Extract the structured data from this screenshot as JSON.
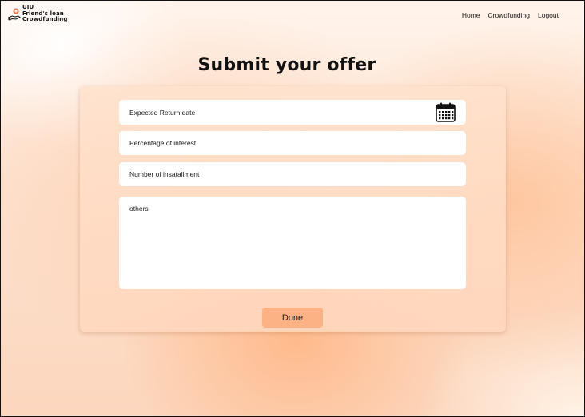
{
  "header": {
    "logo_lines": [
      "UIU",
      "Friend's loan",
      "Crowdfunding"
    ],
    "logo_icon": "hand-coin-icon",
    "nav": [
      "Home",
      "Crowdfunding",
      "Logout"
    ]
  },
  "title": "Submit your offer",
  "form": {
    "return_date_placeholder": "Expected  Return date",
    "calendar_icon": "calendar-icon",
    "interest_placeholder": "Percentage of interest",
    "installment_placeholder": "Number of insatallment",
    "others_placeholder": "others",
    "done_label": "Done"
  },
  "colors": {
    "accent": "#fdb286",
    "background": "#fde2cf",
    "text": "#1a1a1a"
  }
}
